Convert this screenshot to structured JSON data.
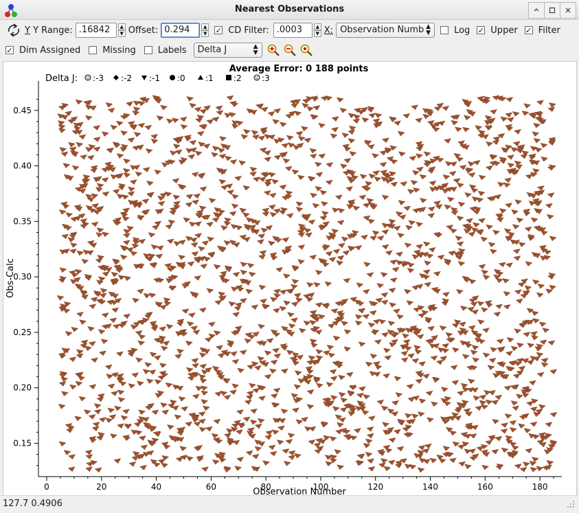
{
  "window": {
    "title": "Nearest Observations"
  },
  "toolbar": {
    "y_range_label": "Y Range:",
    "y_range_value": ".16842",
    "offset_label": "Offset:",
    "offset_value": "0.294",
    "cd_filter_checked": true,
    "cd_filter_label": "CD Filter:",
    "cd_filter_value": ".0003",
    "x_label": "X:",
    "x_select": "Observation Numb",
    "log_label": "Log",
    "log_checked": false,
    "upper_label": "Upper",
    "upper_checked": true,
    "filter_label": "Filter",
    "filter_checked": true,
    "dim_assigned_label": "Dim Assigned",
    "dim_assigned_checked": true,
    "missing_label": "Missing",
    "missing_checked": false,
    "labels_label": "Labels",
    "labels_checked": false,
    "symbol_select": "Delta J",
    "zoom_icons": [
      "zoom-in-icon",
      "zoom-out-icon",
      "zoom-reset-icon"
    ]
  },
  "chart_data": {
    "type": "scatter",
    "title": "Average Error: 0  188 points",
    "xlabel": "Observation Number",
    "ylabel": "Obs-Calc",
    "xlim": [
      -3,
      188
    ],
    "ylim": [
      0.12,
      0.474
    ],
    "x_ticks": [
      "0",
      "20",
      "40",
      "60",
      "80",
      "100",
      "120",
      "140",
      "160",
      "180"
    ],
    "y_ticks": [
      "0.15",
      "0.20",
      "0.25",
      "0.30",
      "0.35",
      "0.40",
      "0.45"
    ],
    "legend_title": "Delta J:",
    "legend": [
      {
        "symbol": "smile-circle",
        "label": ":-3"
      },
      {
        "symbol": "diamond",
        "label": ":-2"
      },
      {
        "symbol": "down-triangle",
        "label": ":-1"
      },
      {
        "symbol": "circle",
        "label": ":0"
      },
      {
        "symbol": "up-triangle",
        "label": ":1"
      },
      {
        "symbol": "square",
        "label": ":2"
      },
      {
        "symbol": "smile-circle-open",
        "label": ":3"
      }
    ],
    "marker_color": "#a0522d",
    "x_range": [
      5,
      185
    ],
    "y_range": [
      0.126,
      0.462
    ],
    "point_count_rendered": 2000,
    "note": "dense field of arrow-shaped markers covering observation numbers ~5-185 and Obs-Calc ~0.126-0.462"
  },
  "status": {
    "text": "127.7  0.4906"
  }
}
